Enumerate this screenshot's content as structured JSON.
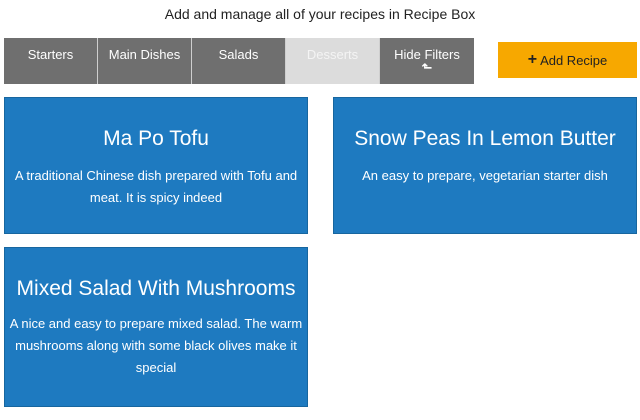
{
  "tagline": "Add and manage all of your recipes in Recipe Box",
  "filters": [
    {
      "label": "Starters",
      "active": false
    },
    {
      "label": "Main Dishes",
      "active": false
    },
    {
      "label": "Salads",
      "active": false
    },
    {
      "label": "Desserts",
      "active": true
    },
    {
      "label": "Hide Filters",
      "active": false
    }
  ],
  "hide_filters_icon": "arrow-up-icon",
  "add_recipe": {
    "label": "Add Recipe",
    "icon": "plus-icon"
  },
  "colors": {
    "card_background": "#1e7ac0",
    "filter_background": "#6f6f6f",
    "filter_active_background": "#dcdcdc",
    "add_button_background": "#f7a800"
  },
  "recipes": [
    {
      "title": "Ma Po Tofu",
      "description": "A traditional Chinese dish prepared with Tofu and meat. It is spicy indeed"
    },
    {
      "title": "Snow Peas In Lemon Butter",
      "description": "An easy to prepare, vegetarian starter dish"
    },
    {
      "title": "Mixed Salad With Mushrooms",
      "description": "A nice and easy to prepare mixed salad. The warm mushrooms along with some black olives make it special"
    }
  ]
}
